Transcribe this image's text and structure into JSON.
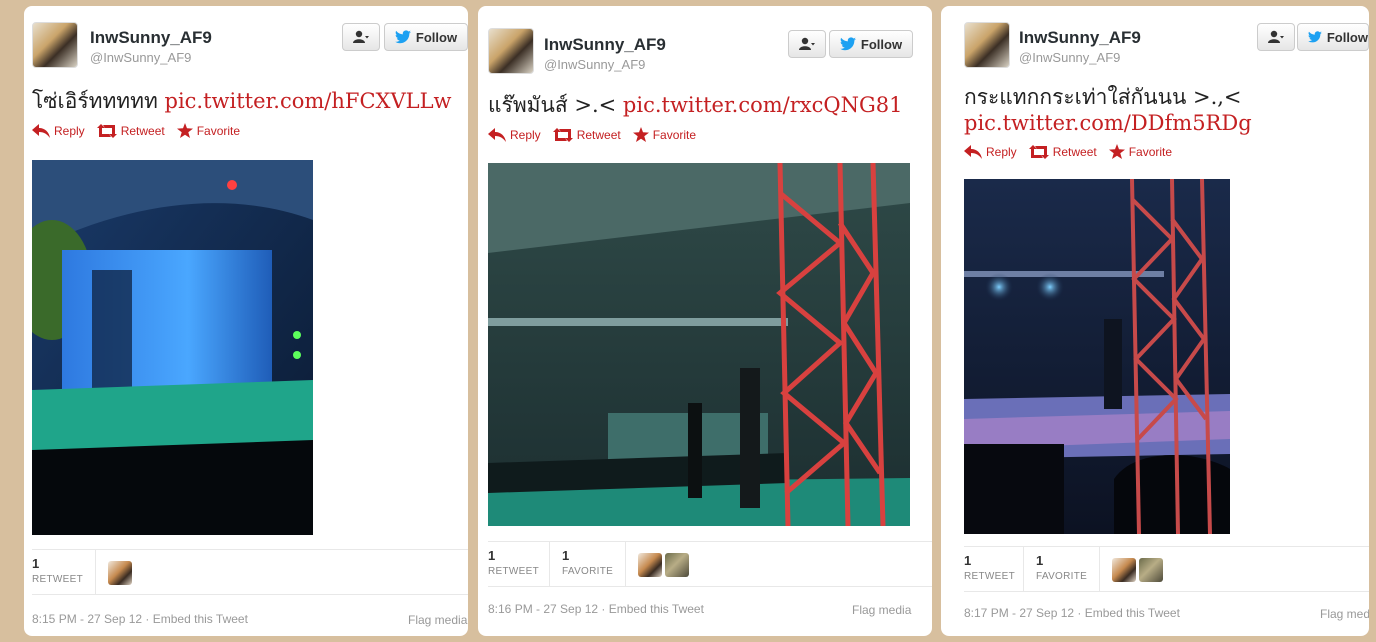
{
  "tweets": [
    {
      "display_name": "InwSunny_AF9",
      "handle": "@InwSunny_AF9",
      "follow_label": "Follow",
      "text": "โซ่เอิร์ททททท",
      "link": "pic.twitter.com/hFCXVLLw",
      "actions": {
        "reply": "Reply",
        "retweet": "Retweet",
        "favorite": "Favorite"
      },
      "stats": [
        {
          "count": "1",
          "label": "RETWEET"
        }
      ],
      "time": "8:15 PM - 27 Sep 12",
      "embed": "Embed this Tweet",
      "flag": "Flag media"
    },
    {
      "display_name": "InwSunny_AF9",
      "handle": "@InwSunny_AF9",
      "follow_label": "Follow",
      "text": "แร๊พมันส์ >.<",
      "link": "pic.twitter.com/rxcQNG81",
      "actions": {
        "reply": "Reply",
        "retweet": "Retweet",
        "favorite": "Favorite"
      },
      "stats": [
        {
          "count": "1",
          "label": "RETWEET"
        },
        {
          "count": "1",
          "label": "FAVORITE"
        }
      ],
      "time": "8:16 PM - 27 Sep 12",
      "embed": "Embed this Tweet",
      "flag": "Flag media"
    },
    {
      "display_name": "InwSunny_AF9",
      "handle": "@InwSunny_AF9",
      "follow_label": "Follow",
      "text": "กระแทกกระเท่าใส่กันนน >.,<",
      "link": "pic.twitter.com/DDfm5RDg",
      "actions": {
        "reply": "Reply",
        "retweet": "Retweet",
        "favorite": "Favorite"
      },
      "stats": [
        {
          "count": "1",
          "label": "RETWEET"
        },
        {
          "count": "1",
          "label": "FAVORITE"
        }
      ],
      "time": "8:17 PM - 27 Sep 12",
      "embed": "Embed this Tweet",
      "flag": "Flag med"
    }
  ],
  "colors": {
    "link": "#c42022",
    "twitter_blue": "#1da1f2",
    "background": "#d7bf9e"
  },
  "icons": [
    "user-icon",
    "twitter-bird-icon",
    "reply-icon",
    "retweet-icon",
    "favorite-star-icon"
  ]
}
